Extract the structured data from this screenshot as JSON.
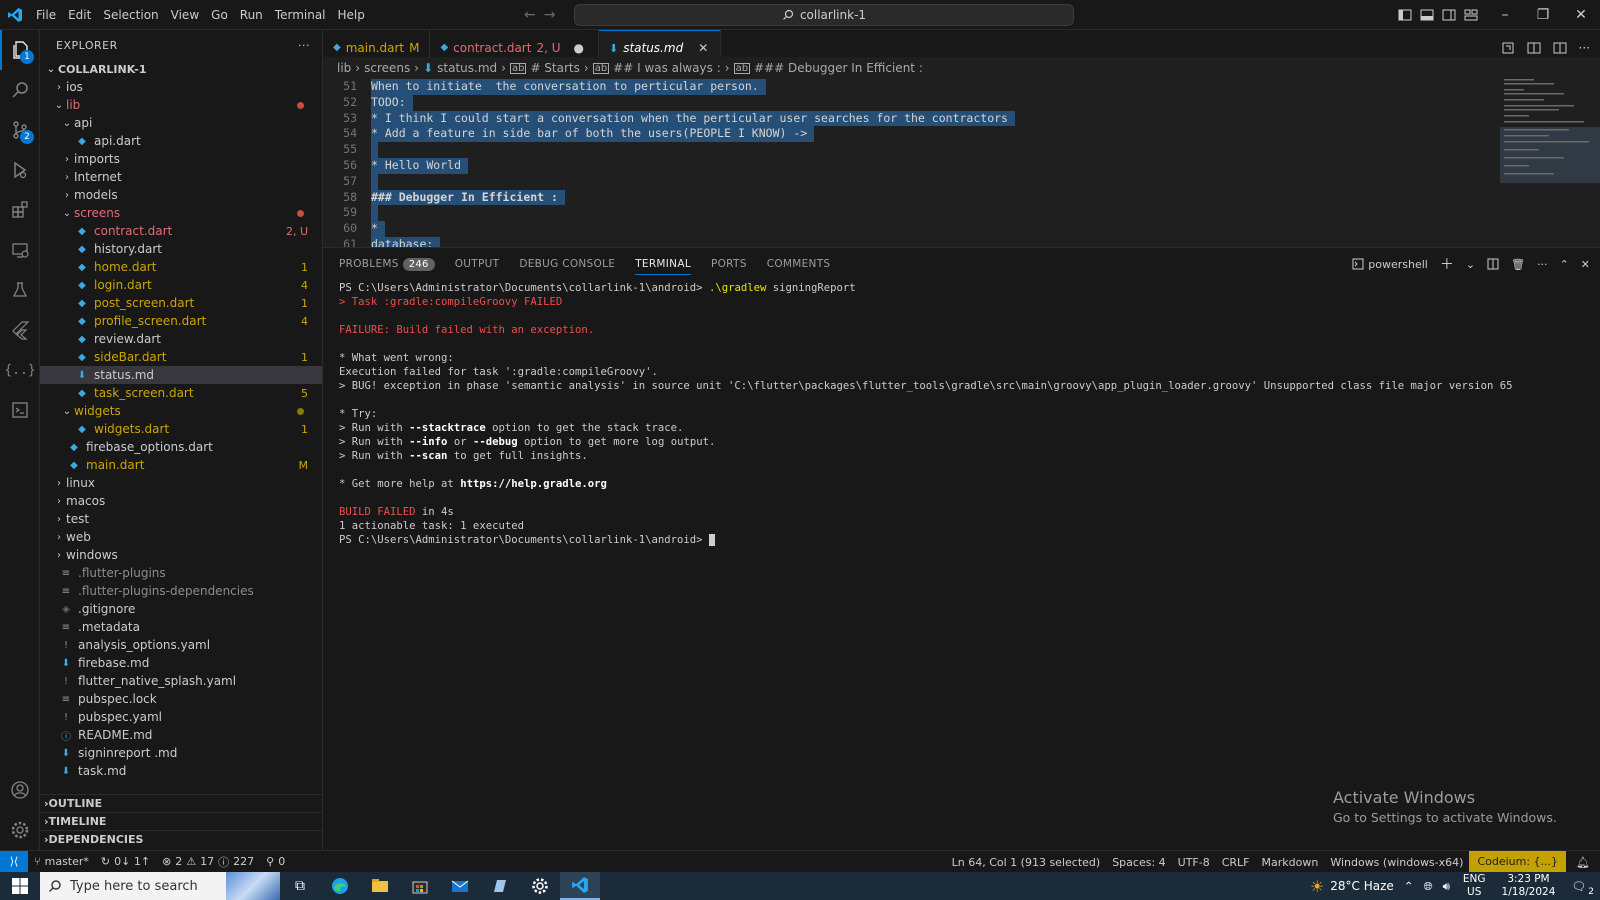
{
  "titlebar": {
    "menu": [
      "File",
      "Edit",
      "Selection",
      "View",
      "Go",
      "Run",
      "Terminal",
      "Help"
    ],
    "search_text": "collarlink-1"
  },
  "activity": {
    "explorer_badge": "1",
    "scm_badge": "2"
  },
  "sidebar": {
    "title": "EXPLORER",
    "more": "···",
    "root": "COLLARLINK-1",
    "tree": [
      {
        "label": "ios",
        "depth": 1,
        "type": "folder",
        "open": false,
        "color": "#cccccc"
      },
      {
        "label": "lib",
        "depth": 1,
        "type": "folder",
        "open": true,
        "color": "#e06c75",
        "dot": "#c74e39"
      },
      {
        "label": "api",
        "depth": 2,
        "type": "folder",
        "open": true,
        "color": "#cccccc"
      },
      {
        "label": "api.dart",
        "depth": 3,
        "type": "dart",
        "color": "#cccccc"
      },
      {
        "label": "imports",
        "depth": 2,
        "type": "folder",
        "open": false,
        "color": "#cccccc"
      },
      {
        "label": "Internet",
        "depth": 2,
        "type": "folder",
        "open": false,
        "color": "#cccccc"
      },
      {
        "label": "models",
        "depth": 2,
        "type": "folder",
        "open": false,
        "color": "#cccccc"
      },
      {
        "label": "screens",
        "depth": 2,
        "type": "folder",
        "open": true,
        "color": "#e06c75",
        "dot": "#c74e39"
      },
      {
        "label": "contract.dart",
        "depth": 3,
        "type": "dart",
        "color": "#e06c75",
        "deco": "2, U",
        "deco_color": "#e06c75"
      },
      {
        "label": "history.dart",
        "depth": 3,
        "type": "dart",
        "color": "#cccccc"
      },
      {
        "label": "home.dart",
        "depth": 3,
        "type": "dart",
        "color": "#cca700",
        "deco": "1",
        "deco_color": "#cca700"
      },
      {
        "label": "login.dart",
        "depth": 3,
        "type": "dart",
        "color": "#cca700",
        "deco": "4",
        "deco_color": "#cca700"
      },
      {
        "label": "post_screen.dart",
        "depth": 3,
        "type": "dart",
        "color": "#cca700",
        "deco": "1",
        "deco_color": "#cca700"
      },
      {
        "label": "profile_screen.dart",
        "depth": 3,
        "type": "dart",
        "color": "#cca700",
        "deco": "4",
        "deco_color": "#cca700"
      },
      {
        "label": "review.dart",
        "depth": 3,
        "type": "dart",
        "color": "#cccccc"
      },
      {
        "label": "sideBar.dart",
        "depth": 3,
        "type": "dart",
        "color": "#cca700",
        "deco": "1",
        "deco_color": "#cca700"
      },
      {
        "label": "status.md",
        "depth": 3,
        "type": "md",
        "color": "#cccccc",
        "selected": true
      },
      {
        "label": "task_screen.dart",
        "depth": 3,
        "type": "dart",
        "color": "#cca700",
        "deco": "5",
        "deco_color": "#cca700"
      },
      {
        "label": "widgets",
        "depth": 2,
        "type": "folder",
        "open": true,
        "color": "#cca700",
        "dot": "#8a7a00"
      },
      {
        "label": "widgets.dart",
        "depth": 3,
        "type": "dart",
        "color": "#cca700",
        "deco": "1",
        "deco_color": "#cca700"
      },
      {
        "label": "firebase_options.dart",
        "depth": 2,
        "type": "dart",
        "color": "#cccccc"
      },
      {
        "label": "main.dart",
        "depth": 2,
        "type": "dart",
        "color": "#cca700",
        "deco": "M",
        "deco_color": "#cca700"
      },
      {
        "label": "linux",
        "depth": 1,
        "type": "folder",
        "open": false,
        "color": "#cccccc"
      },
      {
        "label": "macos",
        "depth": 1,
        "type": "folder",
        "open": false,
        "color": "#cccccc"
      },
      {
        "label": "test",
        "depth": 1,
        "type": "folder",
        "open": false,
        "color": "#cccccc"
      },
      {
        "label": "web",
        "depth": 1,
        "type": "folder",
        "open": false,
        "color": "#cccccc"
      },
      {
        "label": "windows",
        "depth": 1,
        "type": "folder",
        "open": false,
        "color": "#cccccc"
      },
      {
        "label": ".flutter-plugins",
        "depth": 1,
        "type": "lines",
        "color": "#8c8c8c"
      },
      {
        "label": ".flutter-plugins-dependencies",
        "depth": 1,
        "type": "lines",
        "color": "#8c8c8c"
      },
      {
        "label": ".gitignore",
        "depth": 1,
        "type": "git",
        "color": "#cccccc"
      },
      {
        "label": ".metadata",
        "depth": 1,
        "type": "lines",
        "color": "#cccccc"
      },
      {
        "label": "analysis_options.yaml",
        "depth": 1,
        "type": "yaml",
        "color": "#cccccc"
      },
      {
        "label": "firebase.md",
        "depth": 1,
        "type": "md",
        "color": "#cccccc"
      },
      {
        "label": "flutter_native_splash.yaml",
        "depth": 1,
        "type": "yaml",
        "color": "#cccccc"
      },
      {
        "label": "pubspec.lock",
        "depth": 1,
        "type": "lines",
        "color": "#cccccc"
      },
      {
        "label": "pubspec.yaml",
        "depth": 1,
        "type": "yaml",
        "color": "#cccccc"
      },
      {
        "label": "README.md",
        "depth": 1,
        "type": "info",
        "color": "#cccccc"
      },
      {
        "label": "signinreport .md",
        "depth": 1,
        "type": "md",
        "color": "#cccccc"
      },
      {
        "label": "task.md",
        "depth": 1,
        "type": "md",
        "color": "#cccccc"
      }
    ],
    "sections": [
      "OUTLINE",
      "TIMELINE",
      "DEPENDENCIES"
    ]
  },
  "tabs": [
    {
      "label": "main.dart",
      "status": "M",
      "color": "#cca700"
    },
    {
      "label": "contract.dart",
      "status": "2, U",
      "color": "#e06c75",
      "dirty": true
    },
    {
      "label": "status.md",
      "status": "",
      "color": "#cccccc",
      "active": true
    }
  ],
  "breadcrumb": [
    "lib",
    "screens",
    "status.md",
    "# Starts",
    "## I was always :",
    "### Debugger In Efficient :"
  ],
  "editor": {
    "lines": [
      {
        "n": "51",
        "text": "When to initiate  the conversation to perticular person. ",
        "sel": true
      },
      {
        "n": "52",
        "text": "TODO: ",
        "sel": true
      },
      {
        "n": "53",
        "text": "* I think I could start a conversation when the perticular user searches for the contractors ",
        "sel": true
      },
      {
        "n": "54",
        "text": "* Add a feature in side bar of both the users(PEOPLE I KNOW) -> ",
        "sel": true
      },
      {
        "n": "55",
        "text": " ",
        "sel": true
      },
      {
        "n": "56",
        "text": "* Hello World ",
        "sel": true
      },
      {
        "n": "57",
        "text": " ",
        "sel": true
      },
      {
        "n": "58",
        "text": "### Debugger In Efficient : ",
        "sel": true,
        "heading": true
      },
      {
        "n": "59",
        "text": " ",
        "sel": true
      },
      {
        "n": "60",
        "text": "* ",
        "sel": true
      },
      {
        "n": "61",
        "text": "database: ",
        "sel": true
      }
    ]
  },
  "panel": {
    "tabs": [
      "PROBLEMS",
      "OUTPUT",
      "DEBUG CONSOLE",
      "TERMINAL",
      "PORTS",
      "COMMENTS"
    ],
    "problems_count": "246",
    "shell": "powershell"
  },
  "terminal": {
    "l1_prompt": "PS C:\\Users\\Administrator\\Documents\\collarlink-1\\android> ",
    "l1_cmd": ".\\gradlew",
    "l1_arg": " signingReport",
    "l2_a": "> Task :gradle:compileGroovy",
    "l2_b": " FAILED",
    "l3": "FAILURE: Build failed with an exception.",
    "l4": "* What went wrong:",
    "l5": "Execution failed for task ':gradle:compileGroovy'.",
    "l6": "> BUG! exception in phase 'semantic analysis' in source unit 'C:\\flutter\\packages\\flutter_tools\\gradle\\src\\main\\groovy\\app_plugin_loader.groovy' Unsupported class file major version 65",
    "l7": "* Try:",
    "l8_a": "> Run with ",
    "l8_b": "--stacktrace",
    "l8_c": " option to get the stack trace.",
    "l9_a": "> Run with ",
    "l9_b": "--info",
    "l9_c": " or ",
    "l9_d": "--debug",
    "l9_e": " option to get more log output.",
    "l10_a": "> Run with ",
    "l10_b": "--scan",
    "l10_c": " to get full insights.",
    "l11_a": "* Get more help at ",
    "l11_b": "https://help.gradle.org",
    "l12_a": "BUILD FAILED",
    "l12_b": " in 4s",
    "l13": "1 actionable task: 1 executed",
    "l14": "PS C:\\Users\\Administrator\\Documents\\collarlink-1\\android> "
  },
  "watermark": {
    "title": "Activate Windows",
    "subtitle": "Go to Settings to activate Windows."
  },
  "statusbar": {
    "branch": "master*",
    "sync": "0↓ 1↑",
    "errors": "2",
    "warnings": "17",
    "infos": "227",
    "ports": "0",
    "position": "Ln 64, Col 1 (913 selected)",
    "spaces": "Spaces: 4",
    "encoding": "UTF-8",
    "eol": "CRLF",
    "language": "Markdown",
    "platform": "Windows (windows-x64)",
    "codeium": "Codeium: {...}"
  },
  "taskbar": {
    "search_placeholder": "Type here to search",
    "weather": "28°C  Haze",
    "lang1": "ENG",
    "lang2": "US",
    "time": "3:23 PM",
    "date": "1/18/2024",
    "notif_count": "2"
  }
}
